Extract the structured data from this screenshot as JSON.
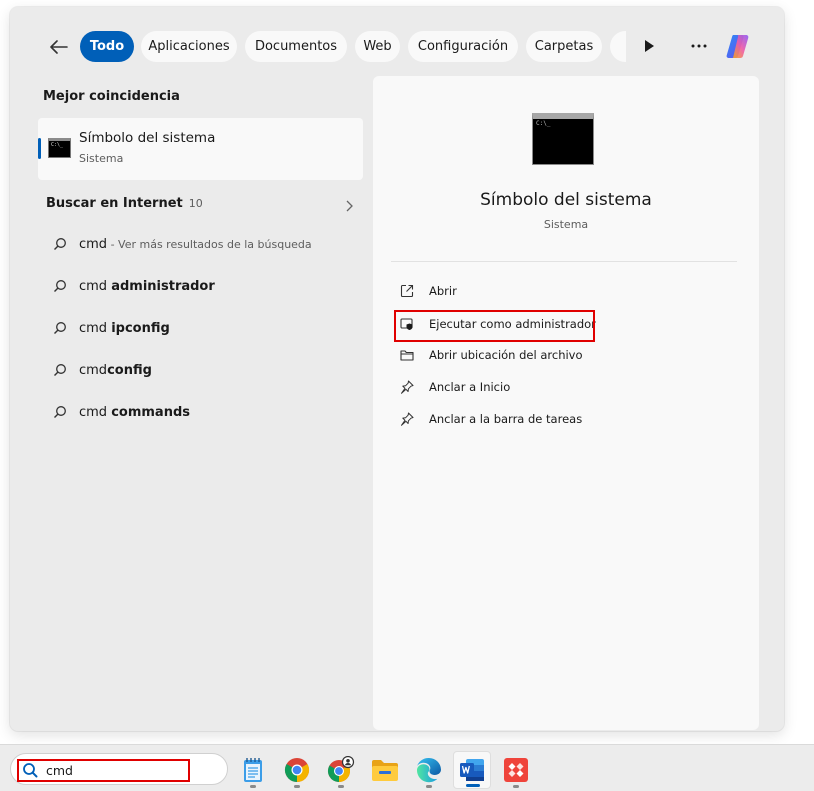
{
  "filters": {
    "back_label": "Volver",
    "chips": [
      {
        "label": "Todo",
        "active": true
      },
      {
        "label": "Aplicaciones",
        "active": false
      },
      {
        "label": "Documentos",
        "active": false
      },
      {
        "label": "Web",
        "active": false
      },
      {
        "label": "Configuración",
        "active": false
      },
      {
        "label": "Carpetas",
        "active": false
      },
      {
        "label": "",
        "active": false
      }
    ],
    "more_icon": "play-right-icon",
    "options_icon": "ellipsis-icon",
    "copilot_icon": "copilot-icon"
  },
  "left": {
    "best_match_label": "Mejor coincidencia",
    "best_match": {
      "title": "Símbolo del sistema",
      "subtitle": "Sistema",
      "icon": "command-prompt-icon"
    },
    "web_label": "Buscar en Internet",
    "web_count": "10",
    "web_results": [
      {
        "prefix": "cmd",
        "bold": "",
        "hint": " - Ver más resultados de la búsqueda"
      },
      {
        "prefix": "cmd ",
        "bold": "administrador",
        "hint": ""
      },
      {
        "prefix": "cmd ",
        "bold": "ipconfig",
        "hint": ""
      },
      {
        "prefix": "cmd",
        "bold": "config",
        "hint": ""
      },
      {
        "prefix": "cmd ",
        "bold": "commands",
        "hint": ""
      }
    ]
  },
  "preview": {
    "title": "Símbolo del sistema",
    "subtitle": "Sistema",
    "icon": "command-prompt-icon",
    "actions": [
      {
        "label": "Abrir",
        "icon": "open-external-icon"
      },
      {
        "label": "Ejecutar como administrador",
        "icon": "shield-icon"
      },
      {
        "label": "Abrir ubicación del archivo",
        "icon": "folder-icon"
      },
      {
        "label": "Anclar a Inicio",
        "icon": "pin-icon"
      },
      {
        "label": "Anclar a la barra de tareas",
        "icon": "pin-icon"
      }
    ]
  },
  "taskbar": {
    "search_value": "cmd",
    "apps": [
      {
        "name": "notepad",
        "icon": "notepad-icon"
      },
      {
        "name": "chrome",
        "icon": "chrome-icon"
      },
      {
        "name": "chrome-profile",
        "icon": "chrome-profile-icon"
      },
      {
        "name": "file-explorer",
        "icon": "folder-icon"
      },
      {
        "name": "edge",
        "icon": "edge-icon"
      },
      {
        "name": "word",
        "icon": "word-icon"
      },
      {
        "name": "anydesk",
        "icon": "anydesk-icon"
      }
    ]
  },
  "colors": {
    "accent": "#005fb8",
    "highlight": "#e00000",
    "panel": "#ebebeb",
    "card": "#f9f9f9"
  }
}
